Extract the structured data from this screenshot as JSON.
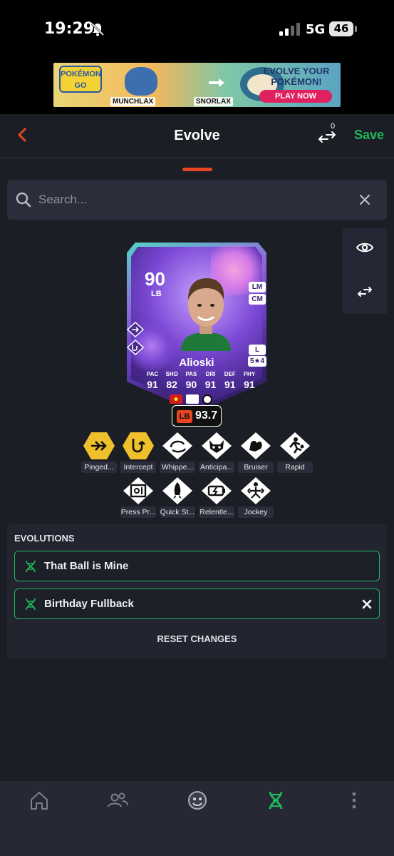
{
  "status_bar": {
    "time": "19:29",
    "network": "5G",
    "battery": "46"
  },
  "ad": {
    "logo_text": "POKÉMON GO",
    "from_label": "MUNCHLAX",
    "to_label": "SNORLAX",
    "headline": "EVOLVE YOUR POKÉMON!",
    "cta": "PLAY NOW"
  },
  "header": {
    "title": "Evolve",
    "compare_count": "0",
    "save_label": "Save"
  },
  "search": {
    "placeholder": "Search..."
  },
  "card": {
    "rating": "90",
    "position": "LB",
    "alt_positions": [
      "LM",
      "CM"
    ],
    "foot": "L",
    "skill_moves": "5★4",
    "name": "Alioski",
    "stats": [
      {
        "label": "PAC",
        "value": "91"
      },
      {
        "label": "SHO",
        "value": "82"
      },
      {
        "label": "PAS",
        "value": "90"
      },
      {
        "label": "DRI",
        "value": "91"
      },
      {
        "label": "DEF",
        "value": "91"
      },
      {
        "label": "PHY",
        "value": "91"
      }
    ],
    "position_rating_label": "LB",
    "position_rating_value": "93.7"
  },
  "playstyles": {
    "row1": [
      {
        "label": "Pinged...",
        "icon": "pinged-pass-icon",
        "plus": true
      },
      {
        "label": "Intercept",
        "icon": "intercept-icon",
        "plus": true
      },
      {
        "label": "Whippe...",
        "icon": "whipped-pass-icon",
        "plus": false
      },
      {
        "label": "Anticipa...",
        "icon": "anticipate-icon",
        "plus": false
      },
      {
        "label": "Bruiser",
        "icon": "bruiser-icon",
        "plus": false
      },
      {
        "label": "Rapid",
        "icon": "rapid-icon",
        "plus": false
      }
    ],
    "row2": [
      {
        "label": "Press Pr...",
        "icon": "press-proven-icon",
        "plus": false
      },
      {
        "label": "Quick St...",
        "icon": "quick-step-icon",
        "plus": false
      },
      {
        "label": "Relentle...",
        "icon": "relentless-icon",
        "plus": false
      },
      {
        "label": "Jockey",
        "icon": "jockey-icon",
        "plus": false
      }
    ]
  },
  "evolutions": {
    "title": "EVOLUTIONS",
    "items": [
      {
        "label": "That Ball is Mine"
      },
      {
        "label": "Birthday Fullback"
      }
    ],
    "reset_label": "RESET CHANGES"
  },
  "colors": {
    "accent_green": "#1fb85a",
    "accent_orange": "#e84521",
    "background": "#1c1e26",
    "plus_gold": "#f0bf2c"
  }
}
